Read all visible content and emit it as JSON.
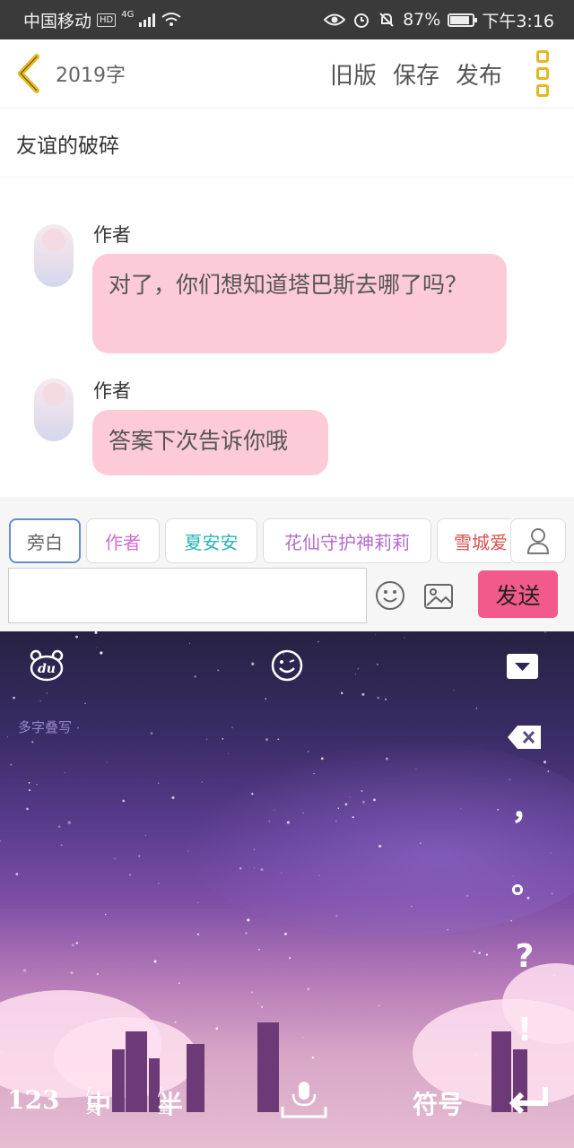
{
  "status_bar": {
    "carrier": "中国移动",
    "hd": "HD",
    "network": "4G",
    "battery": "87%",
    "battery_level": 0.87,
    "time": "下午3:16"
  },
  "header": {
    "word_count": "2019字",
    "old_version": "旧版",
    "save": "保存",
    "publish": "发布"
  },
  "story_title": "友谊的破碎",
  "messages": [
    {
      "author": "作者",
      "text": "对了，你们想知道塔巴斯去哪了吗？"
    },
    {
      "author": "作者",
      "text": "答案下次告诉你哦"
    }
  ],
  "roles": [
    {
      "label": "旁白",
      "color": "#666666",
      "selected": true
    },
    {
      "label": "作者",
      "color": "#d56cd2",
      "selected": false
    },
    {
      "label": "夏安安",
      "color": "#2ab5b5",
      "selected": false
    },
    {
      "label": "花仙守护神莉莉",
      "color": "#b06cc9",
      "selected": false
    },
    {
      "label": "雪城爱",
      "color": "#d9534f",
      "selected": false
    }
  ],
  "composer": {
    "placeholder": "",
    "send": "发送"
  },
  "keyboard": {
    "multi_write": "多字叠写",
    "logo": "du",
    "punctuation": [
      "，",
      "。",
      "?",
      "!"
    ],
    "keys": {
      "num": "123",
      "chinese": "中",
      "chinese_sub": "/英",
      "half": "半",
      "half_sub": "/全",
      "symbols": "符号"
    }
  }
}
